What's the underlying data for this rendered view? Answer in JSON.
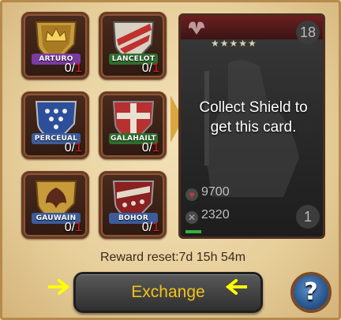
{
  "shields": [
    {
      "name": "ARTURO",
      "owned": "0",
      "needed": "1",
      "color": "#7a3ca0"
    },
    {
      "name": "LANCELOT",
      "owned": "0",
      "needed": "1",
      "color": "#2f6e2f"
    },
    {
      "name": "PERCEUAL",
      "owned": "0",
      "needed": "1",
      "color": "#3c5c9a"
    },
    {
      "name": "GALAHAILT",
      "owned": "0",
      "needed": "1",
      "color": "#2f6e2f"
    },
    {
      "name": "GAUWAIN",
      "owned": "0",
      "needed": "1",
      "color": "#3c5c9a"
    },
    {
      "name": "BOHOR",
      "owned": "0",
      "needed": "1",
      "color": "#3c5c9a"
    }
  ],
  "card": {
    "stars": "★★★★★",
    "level": "18",
    "collect_text": "Collect Shield to get this card.",
    "attack": "9700",
    "defense": "2320",
    "cost": "1"
  },
  "reward_reset": "Reward reset:7d 15h 54m",
  "exchange_label": "Exchange",
  "help_label": "?",
  "colors": {
    "accent": "#f4c21a",
    "arrow": "#ffff00",
    "count_red": "#e21b1b"
  }
}
